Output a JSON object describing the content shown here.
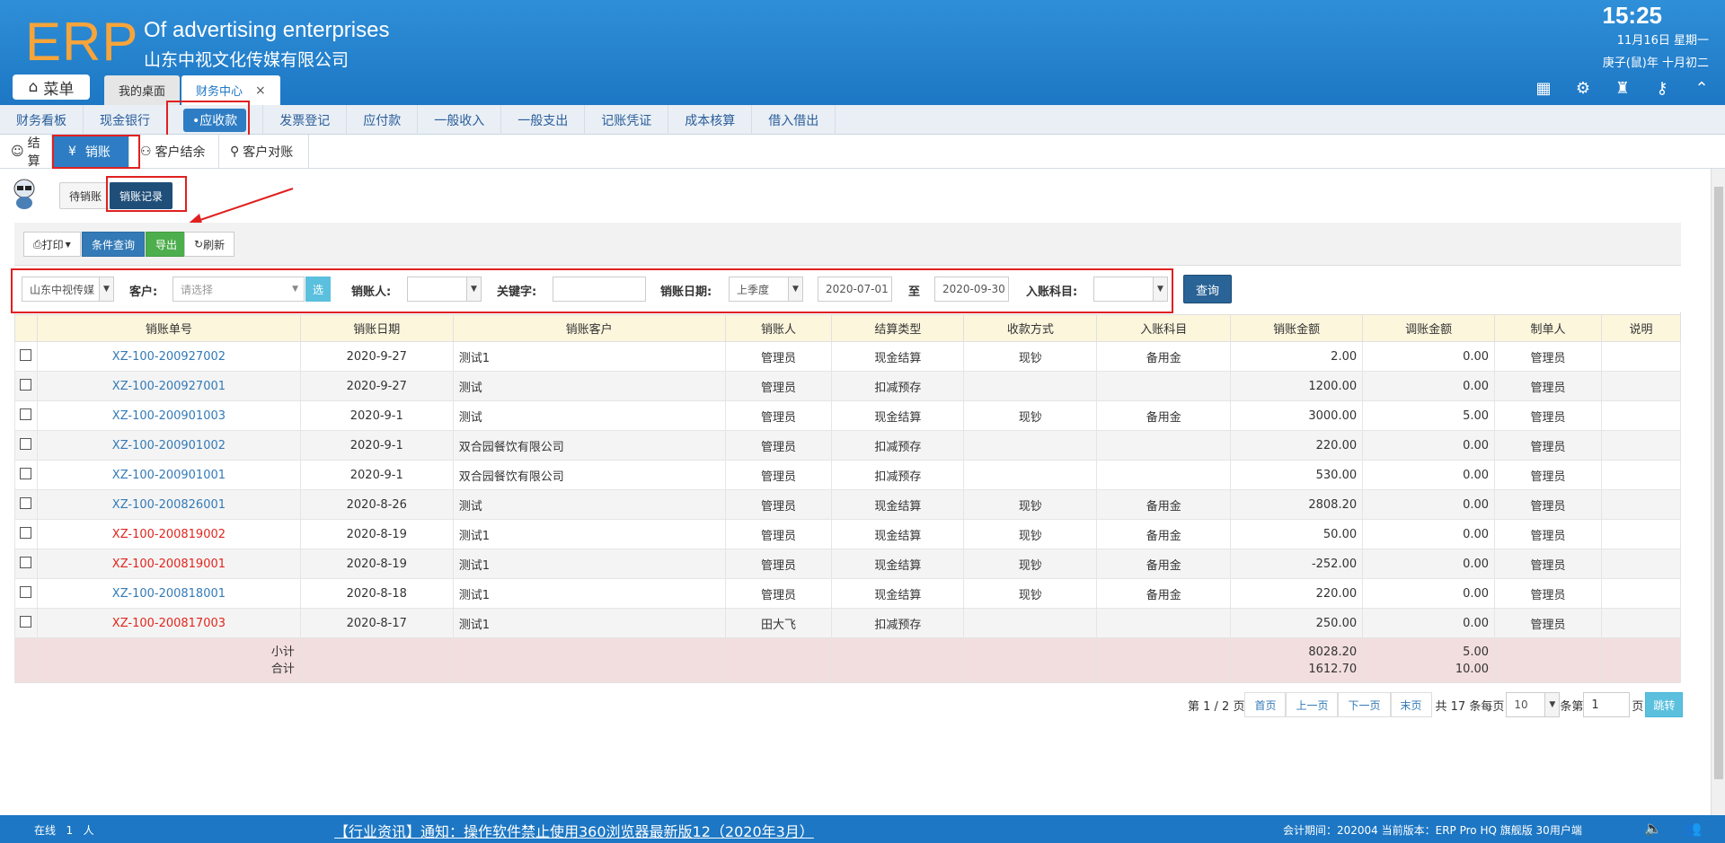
{
  "app": {
    "logo": "ERP",
    "tagline": "Of advertising enterprises",
    "company": "山东中视文化传媒有限公司",
    "time": "15:25",
    "date_line1": "11月16日 星期一",
    "date_line2": "庚子(鼠)年 十月初二",
    "menu_label": "菜单"
  },
  "tabs": [
    {
      "label": "我的桌面"
    },
    {
      "label": "财务中心",
      "close": "×"
    }
  ],
  "nav": [
    "财务看板",
    "现金银行",
    "•应收款",
    "发票登记",
    "应付款",
    "一般收入",
    "一般支出",
    "记账凭证",
    "成本核算",
    "借入借出"
  ],
  "subtabs": [
    "结算",
    "销账",
    "客户结余",
    "客户对账"
  ],
  "pending": {
    "pending_label": "待销账",
    "records_label": "销账记录"
  },
  "toolbar": {
    "print": "打印",
    "query": "条件查询",
    "export": "导出",
    "refresh": "刷新"
  },
  "filter": {
    "company_value": "山东中视传媒",
    "customer_label": "客户:",
    "customer_placeholder": "请选择",
    "choose_btn": "选",
    "salesman_label": "销账人:",
    "keyword_label": "关键字:",
    "date_label": "销账日期:",
    "period_value": "上季度",
    "date_from": "2020-07-01",
    "to_label": "至",
    "date_to": "2020-09-30",
    "account_label": "入账科目:",
    "query_btn": "查询"
  },
  "table": {
    "headers": [
      "销账单号",
      "销账日期",
      "销账客户",
      "销账人",
      "结算类型",
      "收款方式",
      "入账科目",
      "销账金额",
      "调账金额",
      "制单人",
      "说明"
    ],
    "rows": [
      {
        "id": "XZ-100-200927002",
        "red": false,
        "date": "2020-9-27",
        "customer": "测试1",
        "person": "管理员",
        "type": "现金结算",
        "method": "现钞",
        "account": "备用金",
        "amount": "2.00",
        "adjust": "0.00",
        "maker": "管理员",
        "note": ""
      },
      {
        "id": "XZ-100-200927001",
        "red": false,
        "date": "2020-9-27",
        "customer": "测试",
        "person": "管理员",
        "type": "扣减预存",
        "method": "",
        "account": "",
        "amount": "1200.00",
        "adjust": "0.00",
        "maker": "管理员",
        "note": ""
      },
      {
        "id": "XZ-100-200901003",
        "red": false,
        "date": "2020-9-1",
        "customer": "测试",
        "person": "管理员",
        "type": "现金结算",
        "method": "现钞",
        "account": "备用金",
        "amount": "3000.00",
        "adjust": "5.00",
        "maker": "管理员",
        "note": ""
      },
      {
        "id": "XZ-100-200901002",
        "red": false,
        "date": "2020-9-1",
        "customer": "双合园餐饮有限公司",
        "person": "管理员",
        "type": "扣减预存",
        "method": "",
        "account": "",
        "amount": "220.00",
        "adjust": "0.00",
        "maker": "管理员",
        "note": ""
      },
      {
        "id": "XZ-100-200901001",
        "red": false,
        "date": "2020-9-1",
        "customer": "双合园餐饮有限公司",
        "person": "管理员",
        "type": "扣减预存",
        "method": "",
        "account": "",
        "amount": "530.00",
        "adjust": "0.00",
        "maker": "管理员",
        "note": ""
      },
      {
        "id": "XZ-100-200826001",
        "red": false,
        "date": "2020-8-26",
        "customer": "测试",
        "person": "管理员",
        "type": "现金结算",
        "method": "现钞",
        "account": "备用金",
        "amount": "2808.20",
        "adjust": "0.00",
        "maker": "管理员",
        "note": ""
      },
      {
        "id": "XZ-100-200819002",
        "red": true,
        "date": "2020-8-19",
        "customer": "测试1",
        "person": "管理员",
        "type": "现金结算",
        "method": "现钞",
        "account": "备用金",
        "amount": "50.00",
        "adjust": "0.00",
        "maker": "管理员",
        "note": ""
      },
      {
        "id": "XZ-100-200819001",
        "red": true,
        "date": "2020-8-19",
        "customer": "测试1",
        "person": "管理员",
        "type": "现金结算",
        "method": "现钞",
        "account": "备用金",
        "amount": "-252.00",
        "adjust": "0.00",
        "maker": "管理员",
        "note": ""
      },
      {
        "id": "XZ-100-200818001",
        "red": false,
        "date": "2020-8-18",
        "customer": "测试1",
        "person": "管理员",
        "type": "现金结算",
        "method": "现钞",
        "account": "备用金",
        "amount": "220.00",
        "adjust": "0.00",
        "maker": "管理员",
        "note": ""
      },
      {
        "id": "XZ-100-200817003",
        "red": true,
        "date": "2020-8-17",
        "customer": "测试1",
        "person": "田大飞",
        "type": "扣减预存",
        "method": "",
        "account": "",
        "amount": "250.00",
        "adjust": "0.00",
        "maker": "管理员",
        "note": ""
      }
    ],
    "summary": {
      "subtotal_label": "小计",
      "total_label": "合计",
      "subtotal_amount": "8028.20",
      "total_amount": "1612.70",
      "subtotal_adjust": "5.00",
      "total_adjust": "10.00"
    }
  },
  "pager": {
    "page_info": "第 1 / 2 页",
    "first": "首页",
    "prev": "上一页",
    "next": "下一页",
    "last": "末页",
    "total": "共 17 条每页",
    "per_page": "10",
    "goto_prefix": "条第",
    "goto_value": "1",
    "goto_suffix": "页",
    "go_btn": "跳转"
  },
  "footer": {
    "online_label": "在线",
    "online_count": "1",
    "online_unit": "人",
    "news": "【行业资讯】通知：操作软件禁止使用360浏览器最新版12（2020年3月）",
    "version": "会计期间：202004 当前版本：ERP Pro HQ 旗舰版 30用户端"
  },
  "colors": {
    "header": "#1d77c4",
    "logo": "#f7a43a",
    "link": "#337ab7",
    "link_red": "#e0261d",
    "highlight_box": "#e02020"
  }
}
